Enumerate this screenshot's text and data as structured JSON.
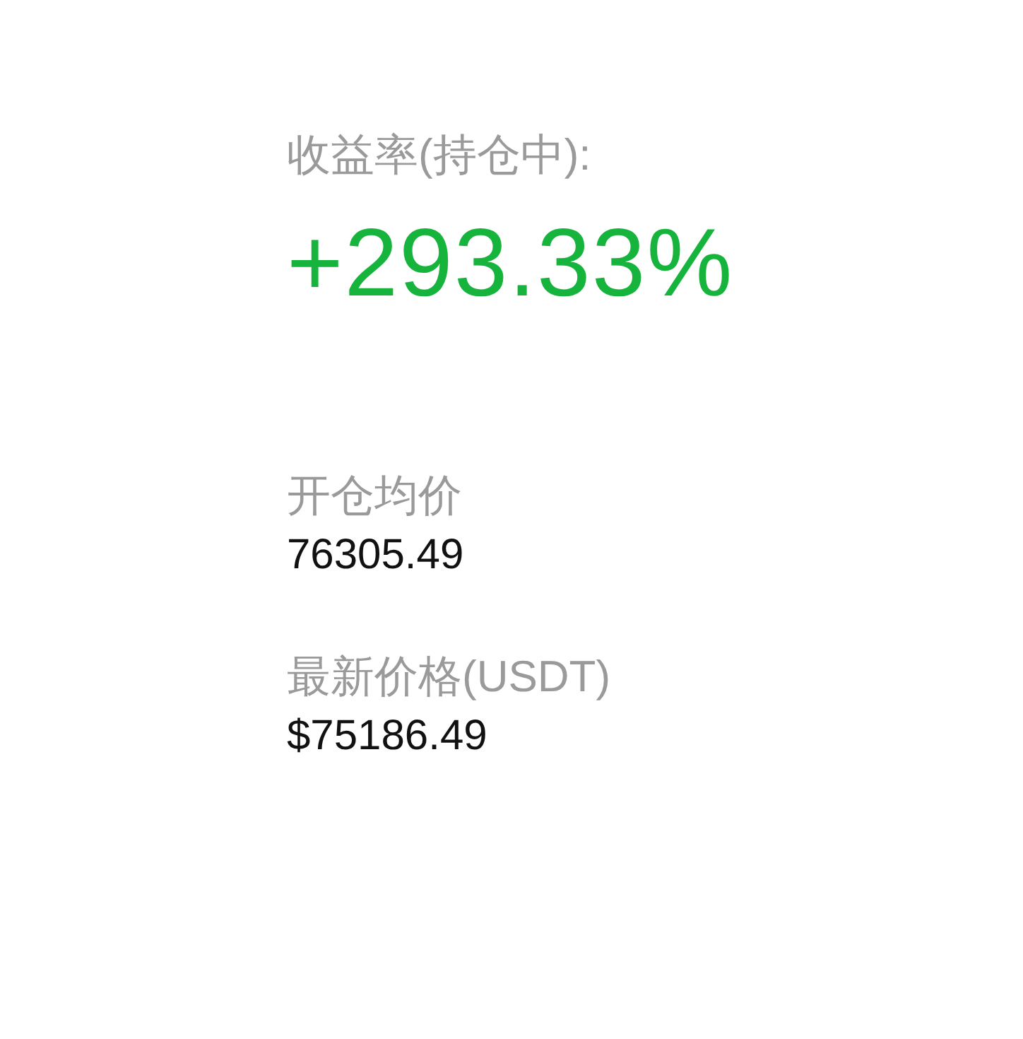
{
  "return_rate": {
    "label": "收益率(持仓中):",
    "value": "+293.33%"
  },
  "stats": [
    {
      "label": "开仓均价",
      "value": "76305.49"
    },
    {
      "label": "最新价格(USDT)",
      "value": "$75186.49"
    }
  ]
}
